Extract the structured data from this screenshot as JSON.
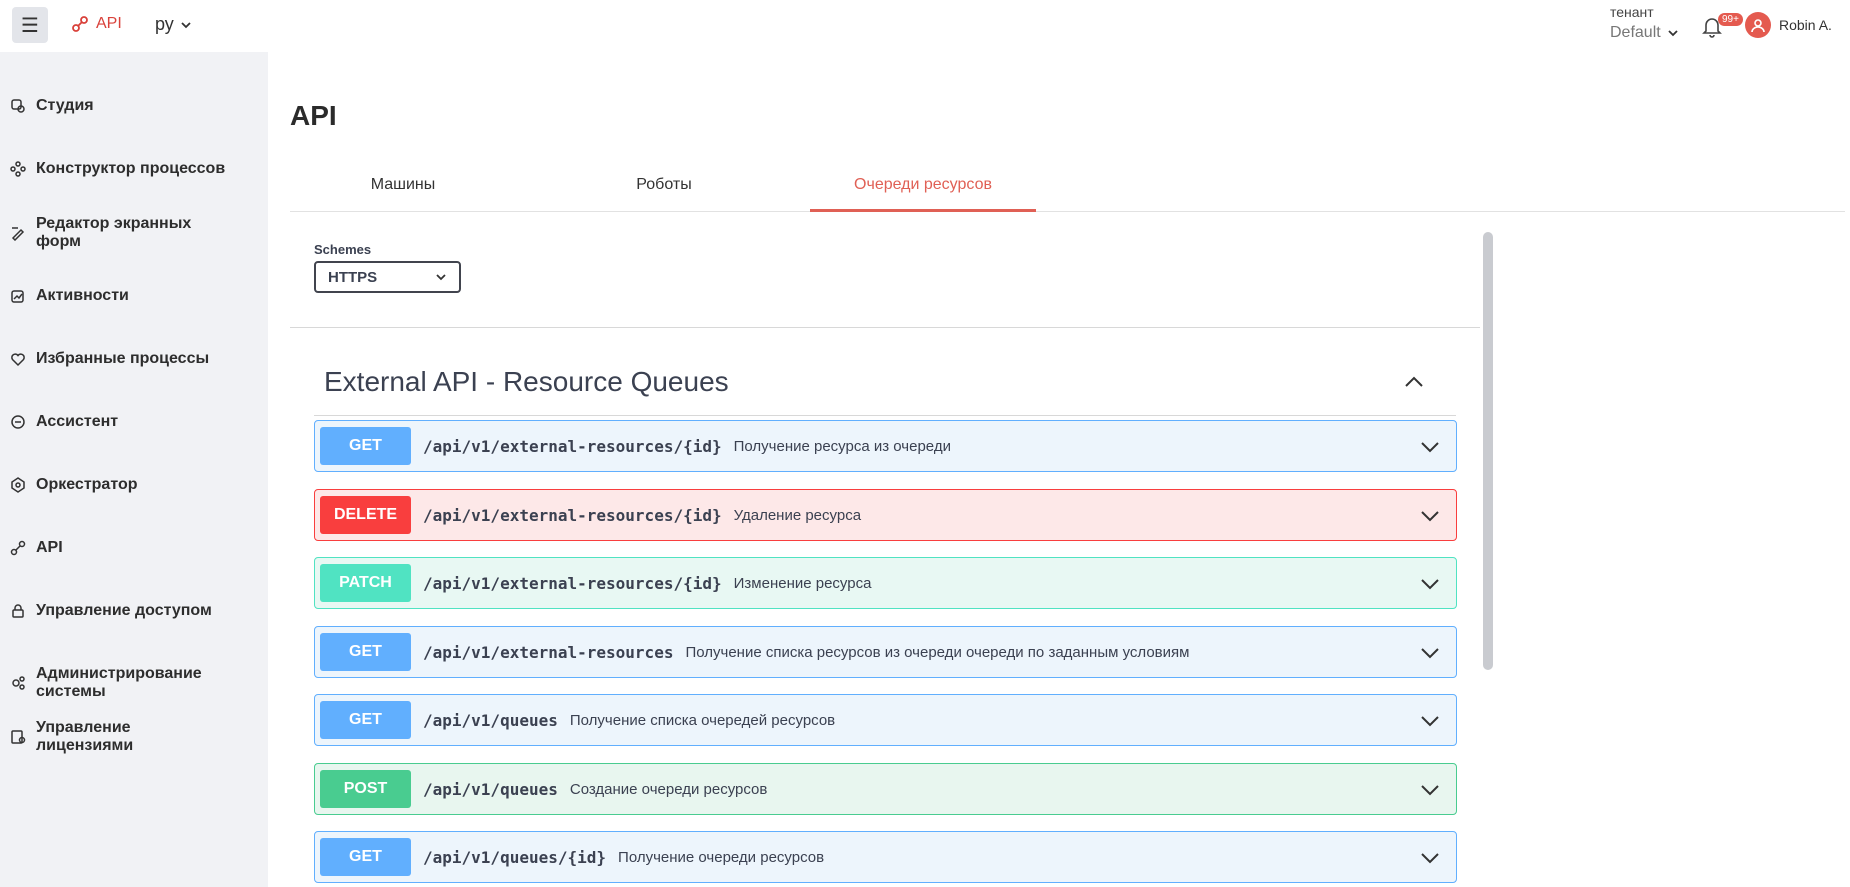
{
  "topbar": {
    "menu_icon": "☰",
    "brand_label": "API",
    "lang": "ру",
    "tenant_label": "тенант",
    "tenant_value": "Default",
    "notifications_badge": "99+",
    "user_name": "Robin A."
  },
  "sidebar": {
    "items": [
      {
        "label": "Студия",
        "icon": "studio-icon"
      },
      {
        "label": "Конструктор процессов",
        "icon": "process-builder-icon"
      },
      {
        "label": "Редактор экранных форм",
        "icon": "form-editor-icon"
      },
      {
        "label": "Активности",
        "icon": "activities-icon"
      },
      {
        "label": "Избранные процессы",
        "icon": "heart-icon"
      },
      {
        "label": "Ассистент",
        "icon": "assistant-icon"
      },
      {
        "label": "Оркестратор",
        "icon": "orchestrator-icon"
      },
      {
        "label": "API",
        "icon": "api-icon"
      },
      {
        "label": "Управление доступом",
        "icon": "lock-icon"
      },
      {
        "label": "Администрирование системы",
        "icon": "admin-gear-icon"
      },
      {
        "label": "Управление лицензиями",
        "icon": "license-icon"
      }
    ]
  },
  "main": {
    "title": "API",
    "tabs": [
      {
        "label": "Машины",
        "active": false
      },
      {
        "label": "Роботы",
        "active": false
      },
      {
        "label": "Очереди ресурсов",
        "active": true
      }
    ],
    "schemes_label": "Schemes",
    "schemes_value": "HTTPS",
    "section_title": "External API - Resource Queues",
    "operations": [
      {
        "method": "GET",
        "path": "/api/v1/external-resources/{id}",
        "desc": "Получение ресурса из очереди"
      },
      {
        "method": "DELETE",
        "path": "/api/v1/external-resources/{id}",
        "desc": "Удаление ресурса"
      },
      {
        "method": "PATCH",
        "path": "/api/v1/external-resources/{id}",
        "desc": "Изменение ресурса"
      },
      {
        "method": "GET",
        "path": "/api/v1/external-resources",
        "desc": "Получение списка ресурсов из очереди очереди по заданным условиям"
      },
      {
        "method": "GET",
        "path": "/api/v1/queues",
        "desc": "Получение списка очередей ресурсов"
      },
      {
        "method": "POST",
        "path": "/api/v1/queues",
        "desc": "Создание очереди ресурсов"
      },
      {
        "method": "GET",
        "path": "/api/v1/queues/{id}",
        "desc": "Получение очереди ресурсов"
      }
    ]
  },
  "colors": {
    "accent": "#e06055",
    "get": "#61affe",
    "delete": "#f93e3e",
    "patch": "#50e3c2",
    "post": "#49cc90"
  }
}
